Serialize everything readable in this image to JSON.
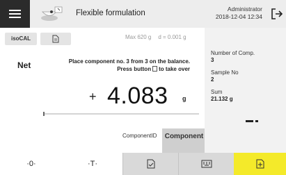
{
  "header": {
    "title": "Flexible formulation",
    "user": "Administrator",
    "datetime": "2018-12-04 12:34",
    "menu_icon": "hamburger-menu-icon",
    "app_icon": "formulation-app-icon",
    "logout_icon": "logout-icon"
  },
  "toolbar": {
    "isocal_label": "isoCAL",
    "doc_icon": "document-icon"
  },
  "balance": {
    "max_capacity": "Max 620 g",
    "readability": "d = 0.001 g",
    "mode": "Net",
    "instruction_line1": "Place component no. 3 from 3 on the balance.",
    "instruction_line2_pre": "Press button",
    "instruction_line2_post": "to take over",
    "sign": "+",
    "weight": "4.083",
    "unit": "g"
  },
  "component": {
    "label": "ComponentID",
    "button_label": "Component"
  },
  "side": {
    "items": [
      {
        "label": "Number of Comp.",
        "value": "3"
      },
      {
        "label": "Sample No",
        "value": "2"
      },
      {
        "label": "Sum",
        "value": "21.132 g"
      }
    ]
  },
  "bottom": {
    "zero_label": "·0·",
    "tare_label": "·T·",
    "b3_icon": "print-document-icon",
    "b4_icon": "keyboard-icon",
    "b5_icon": "take-over-icon"
  },
  "colors": {
    "accent": "#f4ea2a",
    "menu_bg": "#2b2b2b",
    "button_grey": "#d9d9d9"
  }
}
